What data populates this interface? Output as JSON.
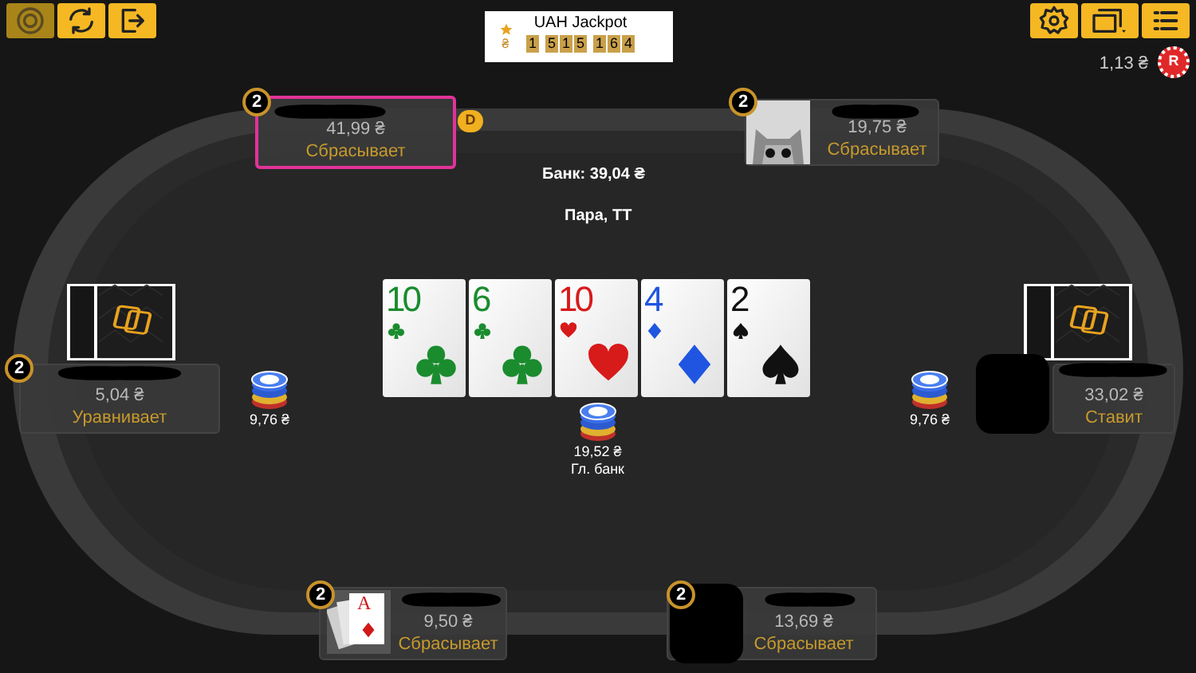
{
  "toolbar_left": [
    {
      "kind": "chip",
      "selected": true
    },
    {
      "kind": "refresh",
      "selected": false
    },
    {
      "kind": "exit",
      "selected": false
    }
  ],
  "jackpot": {
    "title": "UAH Jackpot",
    "currency": "₴",
    "digit_groups": [
      [
        "1"
      ],
      [
        "5",
        "1",
        "5"
      ],
      [
        "1",
        "6",
        "4"
      ]
    ]
  },
  "toolbar_right": [
    {
      "kind": "settings"
    },
    {
      "kind": "layout"
    },
    {
      "kind": "menu"
    }
  ],
  "balance": {
    "amount": "1,13 ₴",
    "badge": "R"
  },
  "pot": {
    "total": "Банк: 39,04 ₴",
    "hand": "Пара, TT",
    "main_pot": "19,52 ₴",
    "main_pot_label": "Гл. банк"
  },
  "dealer_button": "D",
  "board": [
    {
      "rank": "10",
      "kind": "clubs",
      "color": "#1a8c2e"
    },
    {
      "rank": "6",
      "kind": "clubs",
      "color": "#1a8c2e"
    },
    {
      "rank": "10",
      "kind": "hearts",
      "color": "#d71a1a"
    },
    {
      "rank": "4",
      "kind": "diamonds",
      "color": "#1f55e0"
    },
    {
      "rank": "2",
      "kind": "spades",
      "color": "#111111"
    }
  ],
  "seats": [
    {
      "badge": "2",
      "stack": "41,99 ₴",
      "action": "Сбрасывает",
      "highlighted": true,
      "avatar": {
        "kind": "none"
      },
      "cards_shown": false
    },
    {
      "badge": "2",
      "stack": "19,75 ₴",
      "action": "Сбрасывает",
      "highlighted": false,
      "cards_shown": false
    },
    {
      "badge": "2",
      "stack": "5,04 ₴",
      "action": "Уравнивает",
      "highlighted": false,
      "avatar": {
        "kind": "none"
      },
      "cards_shown": true,
      "bet": "9,76 ₴"
    },
    {
      "stack": "33,02 ₴",
      "action": "Ставит",
      "highlighted": false,
      "avatar": {
        "kind": "redacted"
      },
      "cards_shown": true,
      "bet": "9,76 ₴"
    },
    {
      "badge": "2",
      "stack": "9,50 ₴",
      "action": "Сбрасывает",
      "highlighted": false,
      "avatar": {
        "kind": "cards",
        "rank": "A"
      },
      "cards_shown": false
    },
    {
      "badge": "2",
      "stack": "13,69 ₴",
      "action": "Сбрасывает",
      "highlighted": false,
      "avatar": {
        "kind": "redacted"
      },
      "cards_shown": false
    }
  ]
}
